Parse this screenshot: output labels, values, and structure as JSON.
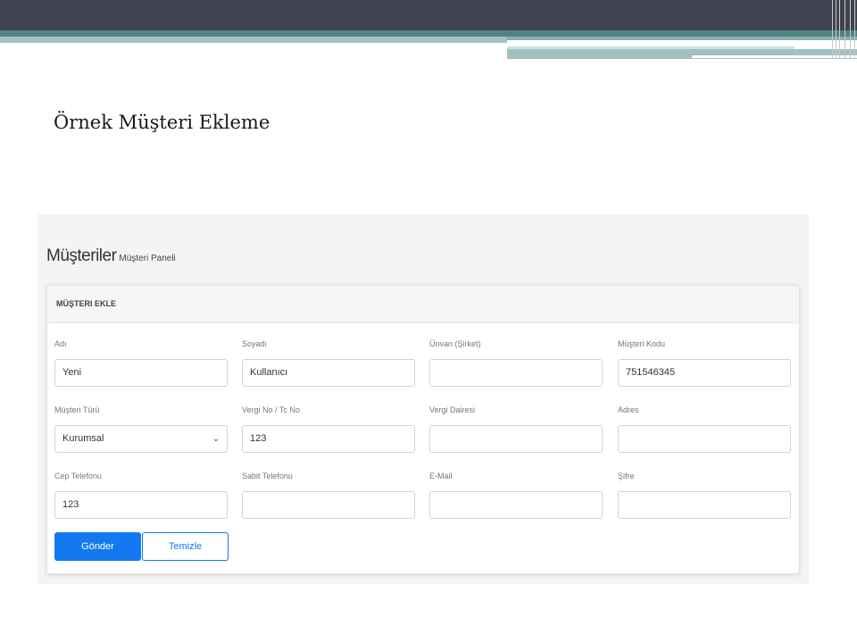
{
  "slide": {
    "title": "Örnek Müşteri Ekleme"
  },
  "page": {
    "heading": "Müşteriler",
    "subheading": "Müşteri Paneli"
  },
  "card": {
    "title": "MÜŞTERI EKLE"
  },
  "form": {
    "fields": [
      {
        "label": "Adı",
        "value": "Yeni"
      },
      {
        "label": "Soyadı",
        "value": "Kullanıcı"
      },
      {
        "label": "Ünvan (Şirket)",
        "value": ""
      },
      {
        "label": "Müşteri Kodu",
        "value": "751546345"
      },
      {
        "label": "Müşteri Türü",
        "value": "Kurumsal"
      },
      {
        "label": "Vergi No / Tc No",
        "value": "123"
      },
      {
        "label": "Vergi Dairesi",
        "value": ""
      },
      {
        "label": "Adres",
        "value": ""
      },
      {
        "label": "Cep Telefonu",
        "value": "123"
      },
      {
        "label": "Sabit Telefonu",
        "value": ""
      },
      {
        "label": "E-Mail",
        "value": ""
      },
      {
        "label": "Şifre",
        "value": ""
      }
    ],
    "submit_label": "Gönder",
    "reset_label": "Temizle"
  },
  "colors": {
    "primary": "#1479f0",
    "header_dark": "#40424f",
    "header_teal": "#4f8382"
  }
}
